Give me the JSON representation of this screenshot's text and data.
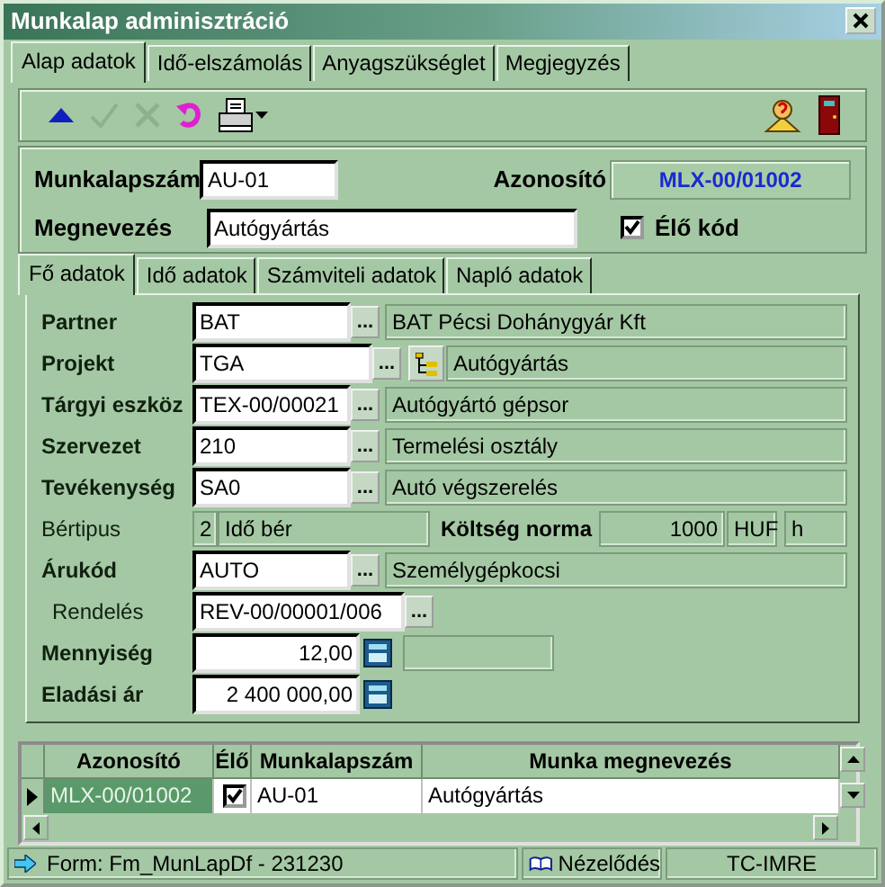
{
  "window": {
    "title": "Munkalap adminisztráció"
  },
  "tabs": [
    {
      "label": "Alap adatok",
      "selected": true
    },
    {
      "label": "Idő-elszámolás",
      "selected": false
    },
    {
      "label": "Anyagszükséglet",
      "selected": false
    },
    {
      "label": "Megjegyzés",
      "selected": false
    }
  ],
  "toolbar": {
    "left": [
      {
        "kind": "up",
        "disabled": false
      },
      {
        "kind": "confirm",
        "disabled": true
      },
      {
        "kind": "cancel",
        "disabled": true
      },
      {
        "kind": "undo",
        "disabled": false
      },
      {
        "kind": "print",
        "disabled": false
      }
    ],
    "right": [
      {
        "kind": "help",
        "disabled": false
      },
      {
        "kind": "exit",
        "disabled": false
      }
    ]
  },
  "header": {
    "number_label": "Munkalapszám",
    "number_value": "AU-01",
    "id_label": "Azonosító",
    "id_value": "MLX-00/01002",
    "name_label": "Megnevezés",
    "name_value": "Autógyártás",
    "live": {
      "label": "Élő kód",
      "checked": true
    }
  },
  "inner_tabs": [
    {
      "label": "Fő adatok",
      "selected": true
    },
    {
      "label": "Idő adatok",
      "selected": false
    },
    {
      "label": "Számviteli adatok",
      "selected": false
    },
    {
      "label": "Napló adatok",
      "selected": false
    }
  ],
  "rows": [
    {
      "kind": "lookup",
      "label": "Partner",
      "bold": true,
      "value": "BAT",
      "button": "...",
      "description": "BAT Pécsi Dohánygyár Kft"
    },
    {
      "kind": "lookup_tree",
      "label": "Projekt",
      "bold": true,
      "value": "TGA",
      "button": "...",
      "description": "Autógyártás"
    },
    {
      "kind": "lookup",
      "label": "Tárgyi eszköz",
      "bold": true,
      "value": "TEX-00/00021",
      "button": "...",
      "description": "Autógyártó gépsor"
    },
    {
      "kind": "lookup",
      "label": "Szervezet",
      "bold": true,
      "value": "210",
      "button": "...",
      "description": "Termelési osztály"
    },
    {
      "kind": "lookup",
      "label": "Tevékenység",
      "bold": true,
      "value": "SA0",
      "button": "...",
      "description": "Autó végszerelés"
    },
    {
      "kind": "pay",
      "label": "Bértipus",
      "bold": false,
      "code": "2",
      "text": "Idő bér",
      "norm_label": "Költség norma",
      "amount": "1000",
      "currency": "HUF",
      "unit": "h"
    },
    {
      "kind": "lookup",
      "label": "Árukód",
      "bold": true,
      "value": "AUTO",
      "button": "...",
      "description": "Személygépkocsi"
    },
    {
      "kind": "order",
      "label": "Rendelés",
      "bold": false,
      "value": "REV-00/00001/006",
      "button": "..."
    },
    {
      "kind": "number_box",
      "label": "Mennyiség",
      "bold": true,
      "value": "12,00"
    },
    {
      "kind": "number",
      "label": "Eladási ár",
      "bold": true,
      "value": "2 400 000,00"
    }
  ],
  "grid": {
    "columns": [
      "Azonosító",
      "Élő",
      "Munkalapszám",
      "Munka megnevezés"
    ],
    "rows": [
      {
        "id": "MLX-00/01002",
        "live": true,
        "number": "AU-01",
        "name": "Autógyártás",
        "selected": true
      }
    ]
  },
  "status_bar": {
    "form": "Form: Fm_MunLapDf - 231230",
    "mode": "Nézelődés",
    "user": "TC-IMRE"
  }
}
